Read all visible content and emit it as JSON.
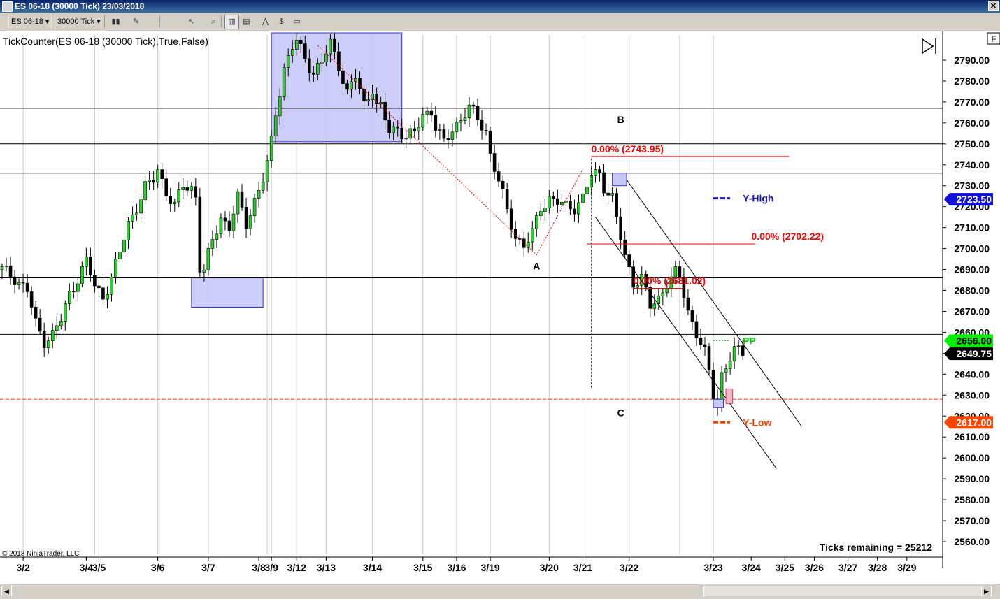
{
  "window": {
    "title": "ES 06-18 (30000 Tick)  23/03/2018"
  },
  "toolbar": {
    "instrument": "ES 06-18",
    "interval": "30000 Tick",
    "icons": [
      "bar-style-icon",
      "draw-pencil-icon",
      "cursor-icon",
      "chart-bars-icon",
      "chart-data-box-icon",
      "strategies-icon",
      "dollar-icon",
      "properties-icon",
      "zoom-icon"
    ]
  },
  "chart_data": {
    "type": "candlestick",
    "indicator_label": "TickCounter(ES 06-18 (30000 Tick),True,False)",
    "copyright": "© 2018 NinjaTrader, LLC",
    "ticks_remaining": "Ticks remaining = 25212",
    "y_axis": {
      "range": [
        2554,
        2802
      ],
      "ticks": [
        "2790.00",
        "2780.00",
        "2770.00",
        "2760.00",
        "2750.00",
        "2740.00",
        "2730.00",
        "2720.00",
        "2710.00",
        "2700.00",
        "2690.00",
        "2680.00",
        "2670.00",
        "2660.00",
        "2650.00",
        "2640.00",
        "2630.00",
        "2620.00",
        "2610.00",
        "2600.00",
        "2590.00",
        "2580.00",
        "2570.00",
        "2560.00"
      ],
      "tick_values": [
        2790,
        2780,
        2770,
        2760,
        2750,
        2740,
        2730,
        2720,
        2710,
        2700,
        2690,
        2680,
        2670,
        2660,
        2650,
        2640,
        2630,
        2620,
        2610,
        2600,
        2590,
        2580,
        2570,
        2560
      ]
    },
    "x_axis": {
      "labels": [
        {
          "text": "3/2",
          "bar": 5
        },
        {
          "text": "3/4",
          "bar": 20
        },
        {
          "text": "3/5",
          "bar": 23
        },
        {
          "text": "3/6",
          "bar": 37
        },
        {
          "text": "3/7",
          "bar": 49
        },
        {
          "text": "3/8",
          "bar": 61
        },
        {
          "text": "3/9",
          "bar": 64
        },
        {
          "text": "3/12",
          "bar": 70
        },
        {
          "text": "3/13",
          "bar": 77
        },
        {
          "text": "3/14",
          "bar": 88
        },
        {
          "text": "3/15",
          "bar": 100
        },
        {
          "text": "3/16",
          "bar": 108
        },
        {
          "text": "3/19",
          "bar": 116
        },
        {
          "text": "3/20",
          "bar": 130
        },
        {
          "text": "3/21",
          "bar": 138
        },
        {
          "text": "3/22",
          "bar": 149
        },
        {
          "text": "3/23",
          "bar": 169
        },
        {
          "text": "3/24",
          "bar": 178
        },
        {
          "text": "3/25",
          "bar": 186
        },
        {
          "text": "3/26",
          "bar": 193
        },
        {
          "text": "3/27",
          "bar": 201
        },
        {
          "text": "3/28",
          "bar": 208
        },
        {
          "text": "3/29",
          "bar": 215
        }
      ],
      "session_lines_bar": [
        5,
        22,
        23,
        37,
        49,
        63,
        64,
        70,
        77,
        88,
        100,
        108,
        116,
        130,
        138,
        149,
        161,
        169
      ]
    },
    "bars_total": 224,
    "close_path": [
      [
        0,
        2690
      ],
      [
        3,
        2686
      ],
      [
        6,
        2680
      ],
      [
        8,
        2664
      ],
      [
        10,
        2656
      ],
      [
        12,
        2659
      ],
      [
        14,
        2666
      ],
      [
        16,
        2678
      ],
      [
        18,
        2686
      ],
      [
        20,
        2694
      ],
      [
        22,
        2682
      ],
      [
        24,
        2677
      ],
      [
        26,
        2686
      ],
      [
        28,
        2698
      ],
      [
        30,
        2712
      ],
      [
        32,
        2720
      ],
      [
        34,
        2729
      ],
      [
        36,
        2733
      ],
      [
        37,
        2738
      ],
      [
        39,
        2727
      ],
      [
        41,
        2720
      ],
      [
        43,
        2730
      ],
      [
        45,
        2729
      ],
      [
        46,
        2725
      ],
      [
        47,
        2691
      ],
      [
        48,
        2689
      ],
      [
        50,
        2704
      ],
      [
        52,
        2715
      ],
      [
        54,
        2710
      ],
      [
        56,
        2724
      ],
      [
        58,
        2712
      ],
      [
        60,
        2723
      ],
      [
        62,
        2733
      ],
      [
        63,
        2740
      ],
      [
        64,
        2751
      ],
      [
        65,
        2765
      ],
      [
        67,
        2786
      ],
      [
        69,
        2796
      ],
      [
        70,
        2799
      ],
      [
        72,
        2791
      ],
      [
        74,
        2784
      ],
      [
        76,
        2789
      ],
      [
        78,
        2798
      ],
      [
        80,
        2788
      ],
      [
        82,
        2774
      ],
      [
        84,
        2782
      ],
      [
        86,
        2769
      ],
      [
        88,
        2777
      ],
      [
        89,
        2768
      ],
      [
        90,
        2767
      ],
      [
        92,
        2756
      ],
      [
        94,
        2758
      ],
      [
        96,
        2753
      ],
      [
        98,
        2755
      ],
      [
        100,
        2764
      ],
      [
        102,
        2766
      ],
      [
        103,
        2758
      ],
      [
        105,
        2750
      ],
      [
        107,
        2757
      ],
      [
        109,
        2762
      ],
      [
        111,
        2767
      ],
      [
        113,
        2762
      ],
      [
        115,
        2756
      ],
      [
        116,
        2745
      ],
      [
        118,
        2732
      ],
      [
        120,
        2718
      ],
      [
        122,
        2706
      ],
      [
        124,
        2701
      ],
      [
        126,
        2707
      ],
      [
        128,
        2720
      ],
      [
        130,
        2724
      ],
      [
        132,
        2722
      ],
      [
        134,
        2720
      ],
      [
        136,
        2720
      ],
      [
        138,
        2724
      ],
      [
        140,
        2735
      ],
      [
        142,
        2736
      ],
      [
        143,
        2730
      ],
      [
        145,
        2724
      ],
      [
        146,
        2714
      ],
      [
        148,
        2696
      ],
      [
        150,
        2684
      ],
      [
        152,
        2686
      ],
      [
        154,
        2672
      ],
      [
        156,
        2676
      ],
      [
        158,
        2684
      ],
      [
        160,
        2688
      ],
      [
        161,
        2686
      ],
      [
        163,
        2670
      ],
      [
        165,
        2660
      ],
      [
        167,
        2650
      ],
      [
        169,
        2630
      ],
      [
        170,
        2625
      ],
      [
        171,
        2640
      ],
      [
        173,
        2648
      ],
      [
        174,
        2651
      ],
      [
        176,
        2650
      ]
    ],
    "current_price": "2649.75",
    "y_high": {
      "label": "Y-High",
      "value": "2723.50"
    },
    "y_low": {
      "label": "Y-Low",
      "value": "2617.00"
    },
    "pp": {
      "label": "PP",
      "value": "2656.00"
    },
    "horizontal_levels": [
      2767,
      2750,
      2736,
      2686,
      2659
    ],
    "dashed_level": 2628,
    "fib_labels": [
      {
        "text": "0.00% (2743.95)",
        "price": 2743.95
      },
      {
        "text": "0.00% (2702.22)",
        "price": 2702.22
      },
      {
        "text": "0.00% (2681.02)",
        "price": 2681.02
      }
    ],
    "wave_labels": [
      {
        "text": "A",
        "bar": 127,
        "price": 2690
      },
      {
        "text": "B",
        "bar": 147,
        "price": 2760
      },
      {
        "text": "C",
        "bar": 147,
        "price": 2620
      }
    ],
    "zones": [
      {
        "bar_from": 64,
        "bar_to": 95,
        "price_from": 2751,
        "price_to": 2803
      },
      {
        "bar_from": 45,
        "bar_to": 62,
        "price_from": 2672,
        "price_to": 2686
      }
    ],
    "channel": {
      "upper": [
        [
          148,
          2734
        ],
        [
          190,
          2615
        ]
      ],
      "lower": [
        [
          141,
          2715
        ],
        [
          184,
          2595
        ]
      ]
    },
    "colors": {
      "bull": "#32cd32",
      "bear": "#000000",
      "fib": "#ff0000",
      "y_high": "#1818c8",
      "y_low": "#ff4500",
      "pp": "#00cc00",
      "zone": "#c8c8f8",
      "dashed": "#ff7a5a"
    }
  },
  "f_button": "F"
}
